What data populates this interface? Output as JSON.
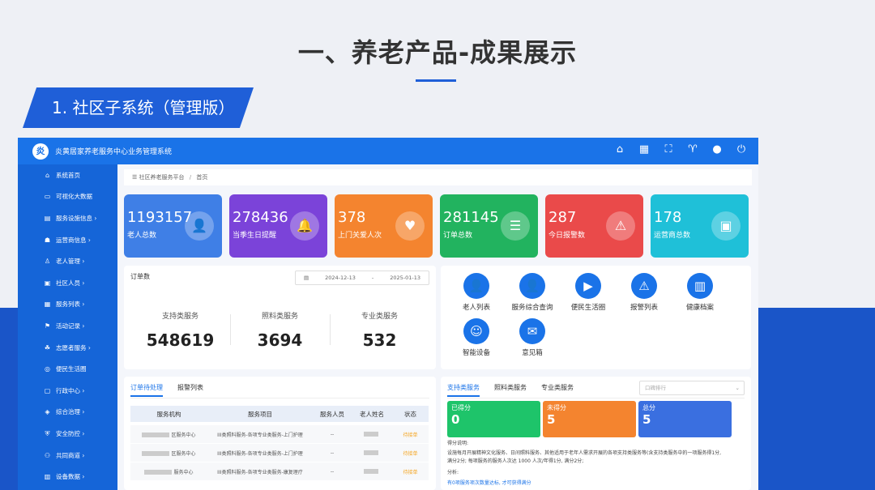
{
  "slide": {
    "title": "一、养老产品-成果展示",
    "section": "1. 社区子系统（管理版）"
  },
  "colors": {
    "brand": "#1a73e8",
    "sidebar": "#1565d8"
  },
  "app": {
    "logo_char": "炎",
    "name": "炎黄居家养老服务中心业务管理系统",
    "top_icons": [
      "home-icon",
      "grid-icon",
      "fullscreen-icon",
      "shirt-icon",
      "user-icon",
      "power-icon"
    ]
  },
  "sidebar": {
    "items": [
      {
        "label": "系统首页",
        "icon": "home-icon"
      },
      {
        "label": "可视化大数据",
        "icon": "monitor-icon"
      },
      {
        "label": "服务设施信息 ›",
        "icon": "building-icon"
      },
      {
        "label": "运营商信息 ›",
        "icon": "people-icon"
      },
      {
        "label": "老人管理 ›",
        "icon": "elder-icon"
      },
      {
        "label": "社区人员 ›",
        "icon": "staff-icon"
      },
      {
        "label": "服务列表 ›",
        "icon": "list-icon"
      },
      {
        "label": "活动记录 ›",
        "icon": "flag-icon"
      },
      {
        "label": "志愿者服务 ›",
        "icon": "volunteer-icon"
      },
      {
        "label": "便民生活圈",
        "icon": "circle-icon"
      },
      {
        "label": "行政中心 ›",
        "icon": "admin-icon"
      },
      {
        "label": "综合治理 ›",
        "icon": "govern-icon"
      },
      {
        "label": "安全防控 ›",
        "icon": "shield-icon"
      },
      {
        "label": "共同商道 ›",
        "icon": "shop-icon"
      },
      {
        "label": "设备数据 ›",
        "icon": "device-icon"
      }
    ]
  },
  "breadcrumb": {
    "root": "社区养老服务平台",
    "sep": "/",
    "current": "首页"
  },
  "stats": [
    {
      "value": "1193157",
      "label": "老人总数",
      "color": "#3f7fe6",
      "icon": "elder-icon",
      "glyph": "👤"
    },
    {
      "value": "278436",
      "label": "当季生日提醒",
      "color": "#7b43d9",
      "icon": "bell-icon",
      "glyph": "🔔"
    },
    {
      "value": "378",
      "label": "上门关爱人次",
      "color": "#f4842f",
      "icon": "heart-hand-icon",
      "glyph": "♥"
    },
    {
      "value": "281145",
      "label": "订单总数",
      "color": "#22b35f",
      "icon": "clipboard-icon",
      "glyph": "☰"
    },
    {
      "value": "287",
      "label": "今日报警数",
      "color": "#ea4a4a",
      "icon": "alarm-icon",
      "glyph": "⚠"
    },
    {
      "value": "178",
      "label": "运营商总数",
      "color": "#1fc0d8",
      "icon": "briefcase-icon",
      "glyph": "▣"
    }
  ],
  "orders": {
    "title": "订单数",
    "date_start": "2024-12-13",
    "date_sep": "-",
    "date_end": "2025-01-13",
    "columns": [
      {
        "label": "支持类服务",
        "value": "548619"
      },
      {
        "label": "照料类服务",
        "value": "3694"
      },
      {
        "label": "专业类服务",
        "value": "532"
      }
    ]
  },
  "quick": [
    {
      "label": "老人列表",
      "icon": "elder-icon",
      "glyph": "👤"
    },
    {
      "label": "服务综合查询",
      "icon": "search-person-icon",
      "glyph": "👤"
    },
    {
      "label": "便民生活圈",
      "icon": "play-icon",
      "glyph": "▶"
    },
    {
      "label": "报警列表",
      "icon": "alarm-icon",
      "glyph": "⚠"
    },
    {
      "label": "健康档案",
      "icon": "books-icon",
      "glyph": "▥"
    },
    {
      "label": "智能设备",
      "icon": "robot-icon",
      "glyph": "☺"
    },
    {
      "label": "意见箱",
      "icon": "mailbox-icon",
      "glyph": "✉"
    }
  ],
  "pending": {
    "tabs": [
      "订单待处理",
      "报警列表"
    ],
    "headers": [
      "服务机构",
      "服务项目",
      "服务人员",
      "老人姓名",
      "状态"
    ],
    "rows": [
      {
        "org": "区服务中心",
        "item": "III类照料服务-各项专业类服务-上门护理",
        "staff": "--",
        "status": "待接单"
      },
      {
        "org": "区服务中心",
        "item": "III类照料服务-各项专业类服务-上门护理",
        "staff": "--",
        "status": "待接单"
      },
      {
        "org": "服务中心",
        "item": "III类照料服务-各项专业类服务-康复理疗",
        "staff": "--",
        "status": "待接单"
      }
    ]
  },
  "scores": {
    "tabs": [
      "支持类服务",
      "照料类服务",
      "专业类服务"
    ],
    "select_placeholder": "口碑排行",
    "cards": [
      {
        "label": "已得分",
        "value": "0",
        "color": "#1ec46a"
      },
      {
        "label": "未得分",
        "value": "5",
        "color": "#f4842f"
      },
      {
        "label": "总分",
        "value": "5",
        "color": "#3a6fe0"
      }
    ],
    "explain_title": "得分说明:",
    "explain_line1": "设施每月开展精神文化服务、日间照料服务、其他适用于老年人需求开展的各项支持类服务等(含支持类服务中的一项服务得1分,",
    "explain_line2": "满分2分; 每项服务的服务人次达 1000 人次/年得1分, 满分2分;",
    "analysis_title": "分析:",
    "link_text": "有0项服务项次数量达标, 才可获得满分"
  }
}
